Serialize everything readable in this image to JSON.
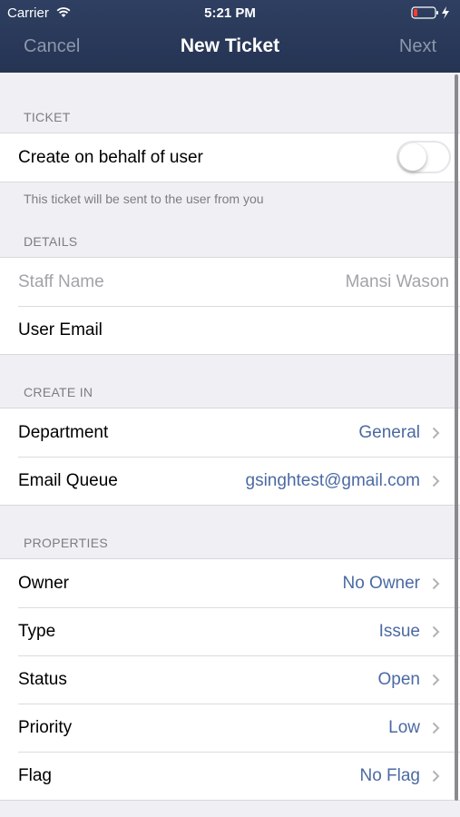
{
  "status_bar": {
    "carrier": "Carrier",
    "time": "5:21 PM"
  },
  "nav": {
    "cancel": "Cancel",
    "title": "New Ticket",
    "next": "Next"
  },
  "sections": {
    "ticket": {
      "header": "TICKET",
      "behalf_label": "Create on behalf of user",
      "behalf_on": false,
      "footer": "This ticket will be sent to the user from you"
    },
    "details": {
      "header": "DETAILS",
      "staff_label": "Staff Name",
      "staff_value": "Mansi Wason",
      "email_label": "User Email"
    },
    "create_in": {
      "header": "CREATE IN",
      "department_label": "Department",
      "department_value": "General",
      "queue_label": "Email Queue",
      "queue_value": "gsinghtest@gmail.com"
    },
    "properties": {
      "header": "PROPERTIES",
      "owner_label": "Owner",
      "owner_value": "No Owner",
      "type_label": "Type",
      "type_value": "Issue",
      "status_label": "Status",
      "status_value": "Open",
      "priority_label": "Priority",
      "priority_value": "Low",
      "flag_label": "Flag",
      "flag_value": "No Flag"
    }
  },
  "colors": {
    "nav_bg": "#2b3a5a",
    "accent": "#4b6aa3",
    "battery_low": "#ff3b30"
  },
  "icons": [
    "wifi-icon",
    "battery-icon",
    "charging-bolt-icon",
    "chevron-right-icon"
  ]
}
